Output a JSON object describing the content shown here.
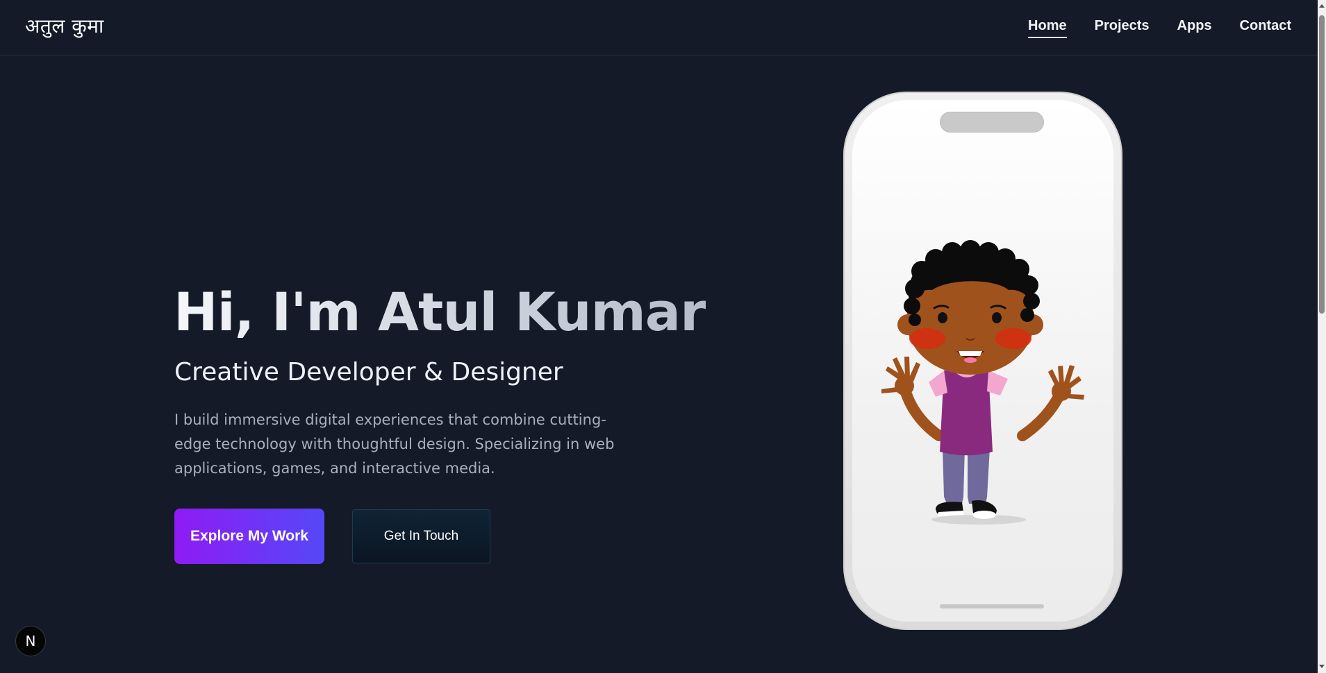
{
  "header": {
    "logo": "अतुल कुमा",
    "nav": [
      {
        "label": "Home",
        "active": true
      },
      {
        "label": "Projects",
        "active": false
      },
      {
        "label": "Apps",
        "active": false
      },
      {
        "label": "Contact",
        "active": false
      }
    ]
  },
  "hero": {
    "title": "Hi, I'm Atul Kumar",
    "subtitle": "Creative Developer & Designer",
    "description": "I build immersive digital experiences that combine cutting-edge technology with thoughtful design. Specializing in web applications, games, and interactive media.",
    "primary_button": "Explore My Work",
    "secondary_button": "Get In Touch"
  },
  "phone": {
    "illustration": "waving-cartoon-boy"
  },
  "badge": {
    "label": "N"
  },
  "colors": {
    "background": "#141a28",
    "primary_gradient_start": "#8f1bf5",
    "primary_gradient_end": "#5548f6",
    "text_primary": "#eef1f6",
    "text_muted": "#a8b0be"
  }
}
